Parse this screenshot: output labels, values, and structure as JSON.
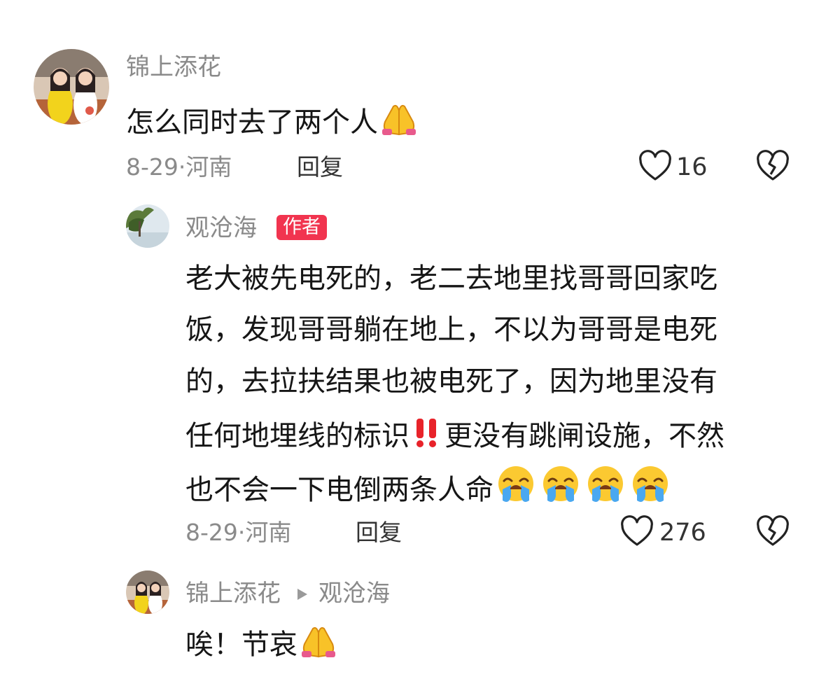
{
  "comments": [
    {
      "author": "锦上添花",
      "text": "怎么同时去了两个人",
      "date": "8-29·",
      "location": "河南",
      "reply_label": "回复",
      "likes": "16"
    },
    {
      "author": "观沧海",
      "author_tag": "作者",
      "text_lines": [
        "老大被先电死的，老二去地里找哥哥回家吃",
        "饭，发现哥哥躺在地上，不以为哥哥是电死",
        "的，去拉扶结果也被电死了，因为地里没有",
        "任何地埋线的标识",
        "更没有跳闸设施，不然",
        "也不会一下电倒两条人命"
      ],
      "date": "8-29·",
      "location": "河南",
      "reply_label": "回复",
      "likes": "276"
    },
    {
      "author": "锦上添花",
      "reply_to": "观沧海",
      "text": "唉！节哀"
    }
  ],
  "icons": {
    "heart": "heart-outline",
    "dislike": "broken-heart-outline",
    "pray": "folded-hands-emoji",
    "cry": "loudly-crying-emoji",
    "alert": "double-exclamation-emoji"
  },
  "colors": {
    "author_tag": "#f1344f",
    "meta_text": "#8a8a8a"
  }
}
